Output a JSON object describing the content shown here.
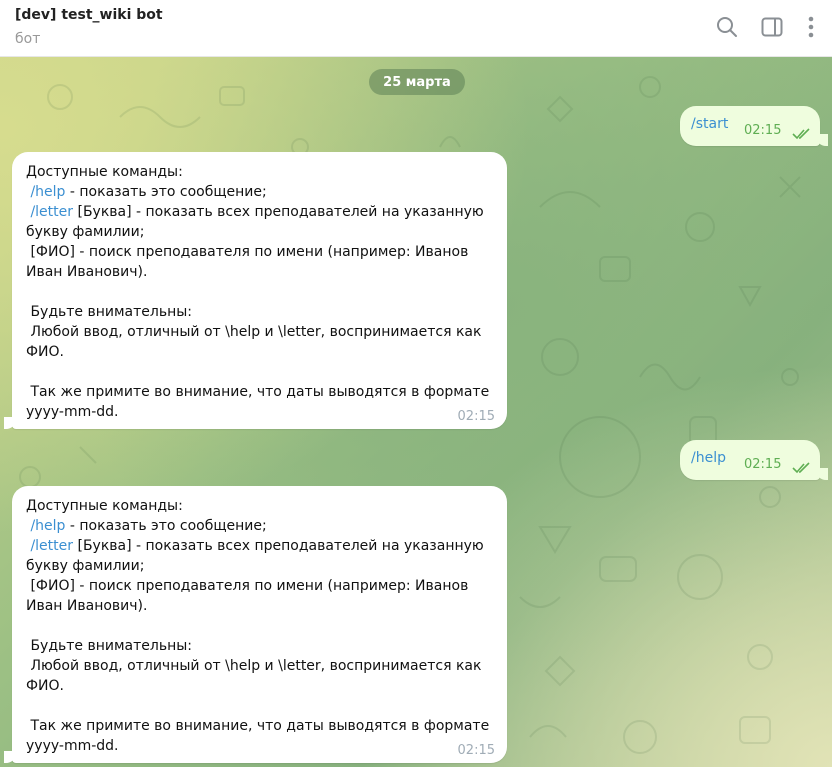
{
  "header": {
    "title": "[dev] test_wiki bot",
    "subtitle": "бот",
    "icons": [
      "search-icon",
      "sidebar-toggle-icon",
      "more-vertical-icon"
    ]
  },
  "chat": {
    "date_label": "25 марта",
    "messages": [
      {
        "direction": "out",
        "text": "/start",
        "time": "02:15",
        "status": "read"
      },
      {
        "direction": "in",
        "time": "02:15",
        "lines": [
          {
            "text": "Доступные команды:"
          },
          {
            "pre": " ",
            "cmd": "/help",
            "text": " - показать это сообщение;"
          },
          {
            "pre": " ",
            "cmd": "/letter",
            "text": " [Буква] - показать всех преподавателей на указанную"
          },
          {
            "text": "букву фамилии;"
          },
          {
            "text": " [ФИО] - поиск преподавателя по имени (например: Иванов"
          },
          {
            "text": "Иван Иванович)."
          },
          {
            "text": ""
          },
          {
            "text": " Будьте внимательны:"
          },
          {
            "text": " Любой ввод, отличный от \\help и \\letter, воспринимается как"
          },
          {
            "text": "ФИО."
          },
          {
            "text": ""
          },
          {
            "text": " Так же примите во внимание, что даты выводятся в формате"
          },
          {
            "text": "yyyy-mm-dd."
          }
        ]
      },
      {
        "direction": "out",
        "text": "/help",
        "time": "02:15",
        "status": "read"
      },
      {
        "direction": "in",
        "time": "02:15",
        "lines": [
          {
            "text": "Доступные команды:"
          },
          {
            "pre": " ",
            "cmd": "/help",
            "text": " - показать это сообщение;"
          },
          {
            "pre": " ",
            "cmd": "/letter",
            "text": " [Буква] - показать всех преподавателей на указанную"
          },
          {
            "text": "букву фамилии;"
          },
          {
            "text": " [ФИО] - поиск преподавателя по имени (например: Иванов"
          },
          {
            "text": "Иван Иванович)."
          },
          {
            "text": ""
          },
          {
            "text": " Будьте внимательны:"
          },
          {
            "text": " Любой ввод, отличный от \\help и \\letter, воспринимается как"
          },
          {
            "text": "ФИО."
          },
          {
            "text": ""
          },
          {
            "text": " Так же примите во внимание, что даты выводятся в формате"
          },
          {
            "text": "yyyy-mm-dd."
          }
        ]
      }
    ]
  },
  "colors": {
    "link": "#3b8fd1",
    "outgoing_bubble": "#effdde",
    "read_check": "#5fae53"
  }
}
